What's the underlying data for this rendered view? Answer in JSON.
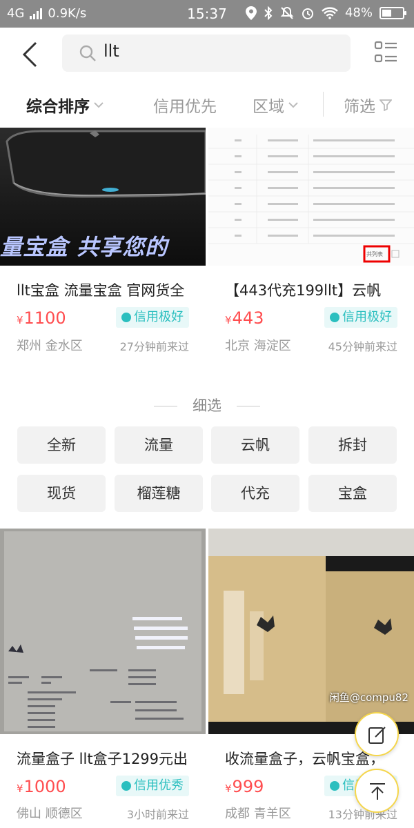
{
  "status_bar": {
    "network": "4G",
    "speed": "0.9K/s",
    "time": "15:37",
    "battery": "48%",
    "battery_level": 0.48
  },
  "header": {
    "search_query": "llt"
  },
  "sort_bar": {
    "items": [
      {
        "label": "综合排序",
        "active": true
      },
      {
        "label": "信用优先",
        "active": false
      },
      {
        "label": "区域",
        "active": false
      },
      {
        "label": "筛选",
        "active": false
      }
    ]
  },
  "products": [
    {
      "title": "llt宝盒 流量宝盒 官网货全",
      "currency": "¥",
      "price": "1100",
      "badge": "信用极好",
      "location": "郑州 金水区",
      "seen": "27分钟前来过",
      "image_text": "量宝盒 共享您的"
    },
    {
      "title": "【443代充199llt】云帆",
      "currency": "¥",
      "price": "443",
      "badge": "信用极好",
      "location": "北京 海淀区",
      "seen": "45分钟前来过",
      "image_text": "共列表"
    },
    {
      "title": "流量盒子 llt盒子1299元出",
      "currency": "¥",
      "price": "1000",
      "badge": "信用优秀",
      "location": "佛山 顺德区",
      "seen": "3小时前来过",
      "image_text": ""
    },
    {
      "title": "收流量盒子，云帆宝盒，",
      "currency": "¥",
      "price": "999",
      "badge": "信用优秀",
      "location": "成都 青羊区",
      "seen": "13分钟前来过",
      "image_text": "闲鱼@compu82"
    }
  ],
  "refine": {
    "title": "细选",
    "chips": [
      "全新",
      "流量",
      "云帆",
      "拆封",
      "现货",
      "榴莲糖",
      "代充",
      "宝盒"
    ]
  },
  "colors": {
    "price": "#ff4d4f",
    "badge_text": "#2bbfbf",
    "badge_bg": "#e8f8f8",
    "fab_border": "#f5d64b"
  }
}
